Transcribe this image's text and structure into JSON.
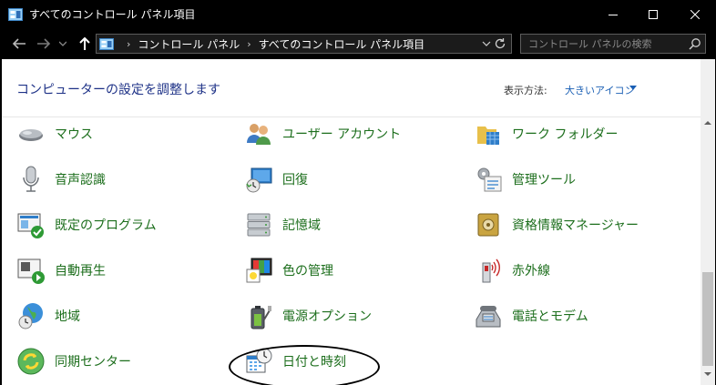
{
  "window": {
    "title": "すべてのコントロール パネル項目",
    "controls": {
      "minimize": "—",
      "maximize": "☐",
      "close": "✕"
    }
  },
  "address": {
    "crumbs": [
      "コントロール パネル",
      "すべてのコントロール パネル項目"
    ],
    "separator": "›",
    "search_placeholder": "コントロール パネルの検索"
  },
  "header": {
    "title": "コンピューターの設定を調整します",
    "view_by_label": "表示方法:",
    "view_by_value": "大きいアイコン"
  },
  "items": [
    {
      "label": "マウス",
      "icon": "mouse-icon"
    },
    {
      "label": "ユーザー アカウント",
      "icon": "user-accounts-icon"
    },
    {
      "label": "ワーク フォルダー",
      "icon": "work-folders-icon"
    },
    {
      "label": "音声認識",
      "icon": "microphone-icon"
    },
    {
      "label": "回復",
      "icon": "recovery-icon"
    },
    {
      "label": "管理ツール",
      "icon": "admin-tools-icon"
    },
    {
      "label": "既定のプログラム",
      "icon": "default-programs-icon"
    },
    {
      "label": "記憶域",
      "icon": "storage-spaces-icon"
    },
    {
      "label": "資格情報マネージャー",
      "icon": "credential-manager-icon"
    },
    {
      "label": "自動再生",
      "icon": "autoplay-icon"
    },
    {
      "label": "色の管理",
      "icon": "color-management-icon"
    },
    {
      "label": "赤外線",
      "icon": "infrared-icon"
    },
    {
      "label": "地域",
      "icon": "region-globe-icon"
    },
    {
      "label": "電源オプション",
      "icon": "power-options-icon"
    },
    {
      "label": "電話とモデム",
      "icon": "phone-modem-icon"
    },
    {
      "label": "同期センター",
      "icon": "sync-center-icon"
    },
    {
      "label": "日付と時刻",
      "icon": "date-time-icon"
    }
  ],
  "colors": {
    "link_green": "#1c6e1c",
    "header_blue": "#1e3287",
    "accent_blue": "#1a5fb4"
  }
}
